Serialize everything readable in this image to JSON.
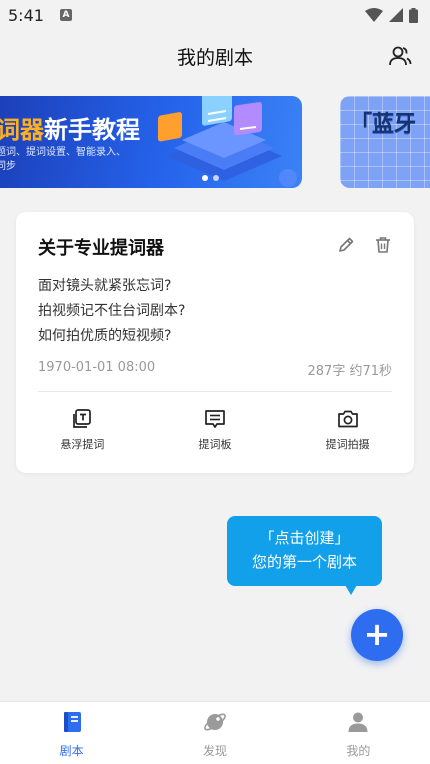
{
  "status_bar": {
    "time": "5:41",
    "notification_badge": "A"
  },
  "header": {
    "title": "我的剧本",
    "users_icon": "users-icon"
  },
  "banners": {
    "main": {
      "title_accent": "词器",
      "title_rest": "新手教程",
      "subtitle": "题词、提词设置、智能录入、\n同步"
    },
    "next": {
      "title_bracket": "「",
      "title": "蓝牙"
    }
  },
  "script_card": {
    "title": "关于专业提词器",
    "lines": [
      "面对镜头就紧张忘词?",
      "拍视频记不住台词剧本?",
      "如何拍优质的短视频?"
    ],
    "date": "1970-01-01 08:00",
    "stats": "287字 约71秒",
    "actions": [
      {
        "label": "悬浮提词",
        "icon": "floating-prompter-icon"
      },
      {
        "label": "提词板",
        "icon": "prompt-board-icon"
      },
      {
        "label": "提词拍摄",
        "icon": "camera-icon"
      }
    ]
  },
  "tooltip": {
    "line1": "「点击创建」",
    "line2": "您的第一个剧本"
  },
  "fab": {
    "label": "+"
  },
  "bottom_nav": [
    {
      "label": "剧本",
      "icon": "script-book-icon",
      "active": true
    },
    {
      "label": "发现",
      "icon": "discover-planet-icon",
      "active": false
    },
    {
      "label": "我的",
      "icon": "profile-icon",
      "active": false
    }
  ],
  "colors": {
    "accent": "#2f6df0",
    "tooltip": "#12a0ea",
    "banner": "#2563eb"
  }
}
